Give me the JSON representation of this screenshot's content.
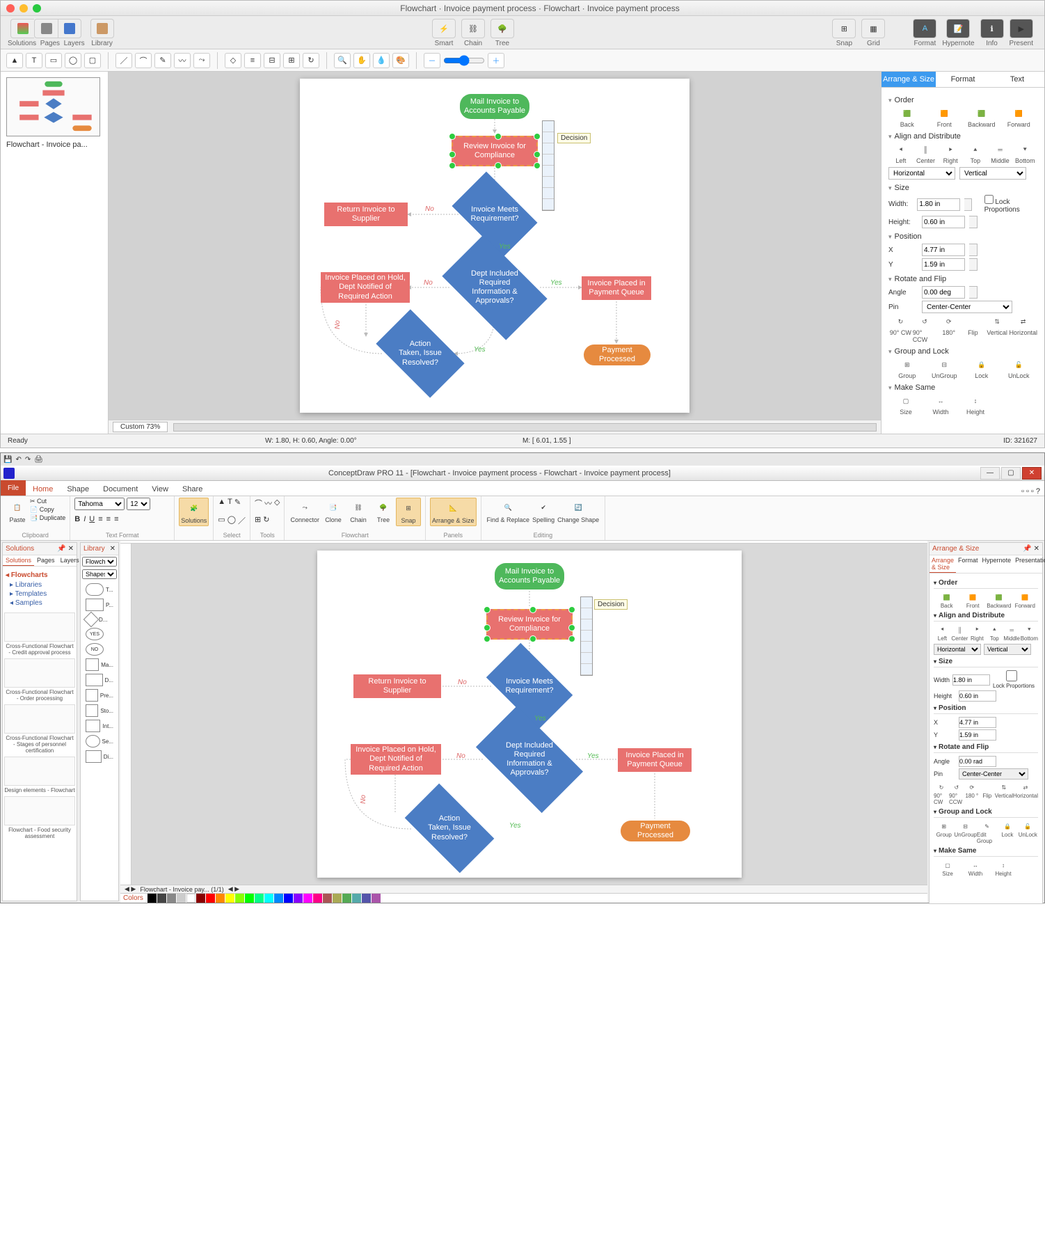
{
  "mac": {
    "title": "Flowchart · Invoice payment process · Flowchart · Invoice payment process",
    "toolbar": {
      "solutions": "Solutions",
      "pages": "Pages",
      "layers": "Layers",
      "library": "Library",
      "smart": "Smart",
      "chain": "Chain",
      "tree": "Tree",
      "snap": "Snap",
      "grid": "Grid",
      "format": "Format",
      "hypernote": "Hypernote",
      "info": "Info",
      "present": "Present"
    },
    "thumb_label": "Flowchart - Invoice pa...",
    "zoom": "Custom 73%",
    "statusbar": {
      "ready": "Ready",
      "dims": "W: 1.80,  H: 0.60,  Angle: 0.00°",
      "mouse": "M: [ 6.01, 1.55 ]",
      "id": "ID: 321627"
    },
    "rp": {
      "tabs": [
        "Arrange & Size",
        "Format",
        "Text"
      ],
      "order": {
        "title": "Order",
        "back": "Back",
        "front": "Front",
        "backward": "Backward",
        "forward": "Forward"
      },
      "align": {
        "title": "Align and Distribute",
        "left": "Left",
        "center": "Center",
        "right": "Right",
        "top": "Top",
        "middle": "Middle",
        "bottom": "Bottom",
        "horizontal": "Horizontal",
        "vertical": "Vertical"
      },
      "size": {
        "title": "Size",
        "width_l": "Width:",
        "width_v": "1.80 in",
        "height_l": "Height:",
        "height_v": "0.60 in",
        "lock": "Lock Proportions"
      },
      "position": {
        "title": "Position",
        "x_l": "X",
        "x_v": "4.77 in",
        "y_l": "Y",
        "y_v": "1.59 in"
      },
      "rotate": {
        "title": "Rotate and Flip",
        "angle_l": "Angle",
        "angle_v": "0.00 deg",
        "pin_l": "Pin",
        "pin_v": "Center-Center",
        "cw": "90° CW",
        "ccw": "90° CCW",
        "r180": "180°",
        "flip": "Flip",
        "fvert": "Vertical",
        "fhoriz": "Horizontal"
      },
      "group": {
        "title": "Group and Lock",
        "group": "Group",
        "ungroup": "UnGroup",
        "lock": "Lock",
        "unlock": "UnLock"
      },
      "same": {
        "title": "Make Same",
        "size": "Size",
        "width": "Width",
        "height": "Height"
      }
    },
    "tooltip": "Decision",
    "flow": {
      "start": "Mail Invoice to Accounts Payable",
      "review": "Review Invoice for Compliance",
      "d1": "Invoice Meets Requirement?",
      "return": "Return Invoice to Supplier",
      "d2": "Dept Included Required Information & Approvals?",
      "hold": "Invoice Placed on Hold, Dept Notified of Required Action",
      "queue": "Invoice Placed in Payment Queue",
      "d3": "Action Taken, Issue Resolved?",
      "processed": "Payment Processed",
      "yes": "Yes",
      "no": "No"
    }
  },
  "win": {
    "title": "ConceptDraw PRO 11 - [Flowchart - Invoice payment process - Flowchart - Invoice payment process]",
    "tabs": {
      "file": "File",
      "home": "Home",
      "shape": "Shape",
      "document": "Document",
      "view": "View",
      "share": "Share"
    },
    "ribbon": {
      "clipboard": {
        "cut": "Cut",
        "copy": "Copy",
        "duplicate": "Duplicate",
        "paste": "Paste",
        "label": "Clipboard"
      },
      "textformat": {
        "font": "Tahoma",
        "size": "12",
        "label": "Text Format"
      },
      "solutions": "Solutions",
      "select": "Select",
      "tools": "Tools",
      "connector": "Connector",
      "clone": "Clone",
      "chain": "Chain",
      "tree": "Tree",
      "snap": "Snap",
      "arrange": "Arrange & Size",
      "flowchart": "Flowchart",
      "panels": "Panels",
      "find": "Find & Replace",
      "spelling": "Spelling",
      "change": "Change Shape",
      "editing": "Editing"
    },
    "solutions_panel": {
      "title": "Solutions",
      "tabs": [
        "Solutions",
        "Pages",
        "Layers"
      ],
      "heading": "Flowcharts",
      "libraries": "Libraries",
      "templates": "Templates",
      "samples": "Samples",
      "sample1": "Cross-Functional Flowchart - Credit approval process",
      "sample2": "Cross-Functional Flowchart - Order processing",
      "sample3": "Cross-Functional Flowchart - Stages of personnel certification",
      "sample4": "Design elements - Flowchart",
      "sample5": "Flowchart - Food security assessment"
    },
    "library_panel": {
      "title": "Library",
      "dropdown": "Flowch...",
      "shapes": "Shapes",
      "items": [
        "T...",
        "P...",
        "D...",
        "YES",
        "NO",
        "Ma...",
        "D...",
        "Pre...",
        "Sto...",
        "Int...",
        "Se...",
        "Di..."
      ]
    },
    "canvas_tab": "Flowchart - Invoice pay...  (1/1)",
    "colors": "Colors",
    "rp": {
      "title": "Arrange & Size",
      "tabs": [
        "Arrange & Size",
        "Format",
        "Hypernote",
        "Presentation"
      ],
      "order": {
        "title": "Order",
        "back": "Back",
        "front": "Front",
        "backward": "Backward",
        "forward": "Forward"
      },
      "align": {
        "title": "Align and Distribute",
        "left": "Left",
        "center": "Center",
        "right": "Right",
        "top": "Top",
        "middle": "Middle",
        "bottom": "Bottom",
        "horizontal": "Horizontal",
        "vertical": "Vertical"
      },
      "size": {
        "title": "Size",
        "width_l": "Width",
        "width_v": "1.80 in",
        "height_l": "Height",
        "height_v": "0.60 in",
        "lock": "Lock Proportions"
      },
      "position": {
        "title": "Position",
        "x_l": "X",
        "x_v": "4.77 in",
        "y_l": "Y",
        "y_v": "1.59 in"
      },
      "rotate": {
        "title": "Rotate and Flip",
        "angle_l": "Angle",
        "angle_v": "0.00 rad",
        "pin_l": "Pin",
        "pin_v": "Center-Center",
        "cw": "90° CW",
        "ccw": "90° CCW",
        "r180": "180 °",
        "flip": "Flip",
        "fvert": "Vertical",
        "fhoriz": "Horizontal"
      },
      "group": {
        "title": "Group and Lock",
        "group": "Group",
        "ungroup": "UnGroup",
        "edit": "Edit Group",
        "lock": "Lock",
        "unlock": "UnLock"
      },
      "same": {
        "title": "Make Same",
        "size": "Size",
        "width": "Width",
        "height": "Height"
      }
    },
    "tooltip": "Decision",
    "flow": {
      "start": "Mail Invoice to Accounts Payable",
      "review": "Review Invoice for Compliance",
      "d1": "Invoice Meets Requirement?",
      "return": "Return Invoice to Supplier",
      "d2": "Dept Included Required Information & Approvals?",
      "hold": "Invoice Placed on Hold, Dept Notified of Required Action",
      "queue": "Invoice Placed in Payment Queue",
      "d3": "Action Taken, Issue Resolved?",
      "processed": "Payment Processed",
      "yes": "Yes",
      "no": "No"
    }
  }
}
